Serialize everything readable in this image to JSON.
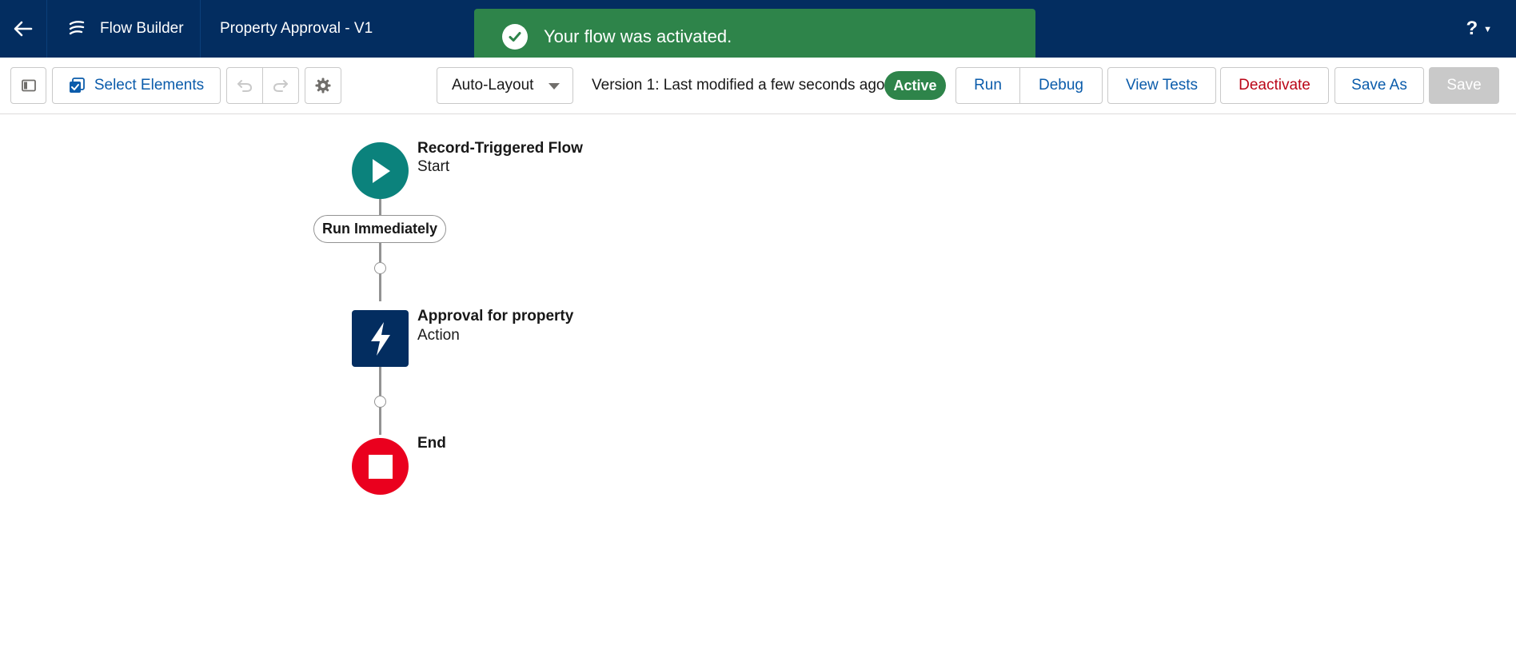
{
  "header": {
    "app_name": "Flow Builder",
    "flow_title": "Property Approval - V1",
    "help_label": "?"
  },
  "toast": {
    "message": "Your flow was activated.",
    "color": "#2e844a"
  },
  "toolbar": {
    "select_elements_label": "Select Elements",
    "layout_select_value": "Auto-Layout",
    "version_text": "Version 1: Last modified a few seconds ago",
    "status_badge": "Active",
    "run_label": "Run",
    "debug_label": "Debug",
    "view_tests_label": "View Tests",
    "deactivate_label": "Deactivate",
    "save_as_label": "Save As",
    "save_label": "Save"
  },
  "flow": {
    "start": {
      "title": "Record-Triggered Flow",
      "subtitle": "Start",
      "color": "#0b827c"
    },
    "path_label": "Run Immediately",
    "action": {
      "title": "Approval for property",
      "subtitle": "Action",
      "color": "#032d60"
    },
    "end": {
      "title": "End",
      "color": "#ea001e"
    }
  },
  "colors": {
    "header_bg": "#032d60",
    "brand_link": "#0b5cab",
    "danger": "#ba0517"
  },
  "icons": [
    "arrow-left-icon",
    "flow-builder-logo-icon",
    "check-icon",
    "panel-icon",
    "select-elements-icon",
    "undo-icon",
    "redo-icon",
    "gear-icon",
    "chevron-down-icon",
    "play-icon",
    "lightning-icon",
    "stop-icon"
  ]
}
